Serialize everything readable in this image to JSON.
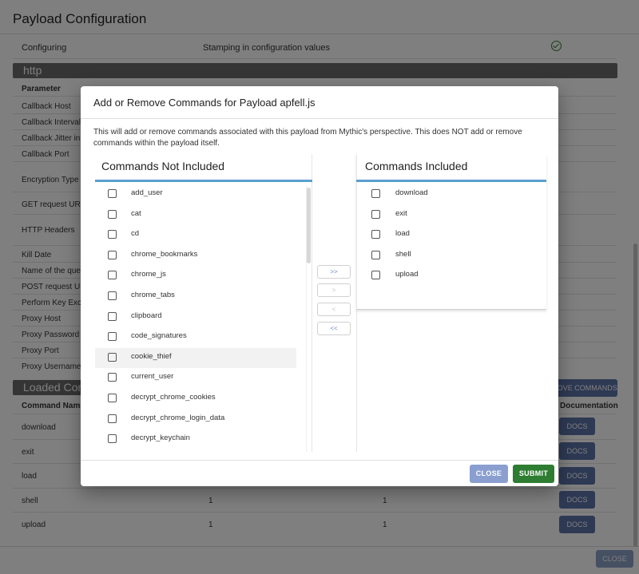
{
  "background": {
    "page_title": "Payload Configuration",
    "config_row": {
      "label": "Configuring",
      "value": "Stamping in configuration values"
    },
    "http_section": "http",
    "param_header": "Parameter",
    "params": [
      "Callback Host",
      "Callback Interval in",
      "Callback Jitter in pe",
      "Callback Port",
      "Encryption Type",
      "GET request URI (d",
      "HTTP Headers",
      "Kill Date",
      "Name of the query",
      "POST request URI (",
      "Perform Key Exchar",
      "Proxy Host",
      "Proxy Password",
      "Proxy Port",
      "Proxy Username"
    ],
    "loaded_section": "Loaded Comm",
    "remove_button": "MOVE COMMANDS",
    "cmd_header": "Command Name",
    "doc_header": "Documentation",
    "commands": [
      {
        "name": "download",
        "a": "",
        "b": ""
      },
      {
        "name": "exit",
        "a": "",
        "b": ""
      },
      {
        "name": "load",
        "a": "",
        "b": ""
      },
      {
        "name": "shell",
        "a": "1",
        "b": "1"
      },
      {
        "name": "upload",
        "a": "1",
        "b": "1"
      }
    ],
    "docs_label": "DOCS",
    "bottom_close": "CLOSE"
  },
  "dialog": {
    "title": "Add or Remove Commands for Payload apfell.js",
    "description": "This will add or remove commands associated with this payload from Mythic's perspective. This does NOT add or remove commands within the payload itself.",
    "left_title": "Commands Not Included",
    "right_title": "Commands Included",
    "not_included": [
      "add_user",
      "cat",
      "cd",
      "chrome_bookmarks",
      "chrome_js",
      "chrome_tabs",
      "clipboard",
      "code_signatures",
      "cookie_thief",
      "current_user",
      "decrypt_chrome_cookies",
      "decrypt_chrome_login_data",
      "decrypt_keychain"
    ],
    "included": [
      "download",
      "exit",
      "load",
      "shell",
      "upload"
    ],
    "move_buttons": {
      "all_right": ">>",
      "right": ">",
      "left": "<",
      "all_left": "<<"
    },
    "close_label": "CLOSE",
    "submit_label": "SUBMIT"
  },
  "colors": {
    "accent_rule": "#5a9fd0",
    "submit_green": "#2e7d32",
    "close_blue": "#8a9fd0",
    "docs_blue": "#5d73a8"
  }
}
